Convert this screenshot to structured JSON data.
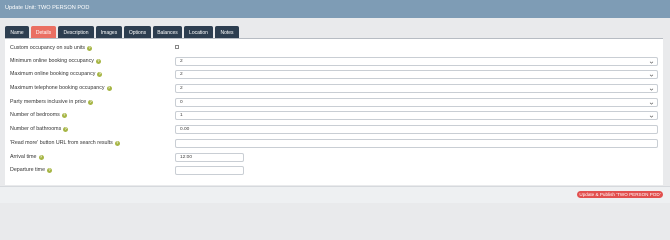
{
  "window": {
    "title": "Update Unit: TWO PERSON POD"
  },
  "tabs": [
    {
      "label": "Name",
      "active": false
    },
    {
      "label": "Details",
      "active": true
    },
    {
      "label": "Description",
      "active": false
    },
    {
      "label": "Images",
      "active": false
    },
    {
      "label": "Options",
      "active": false
    },
    {
      "label": "Balances",
      "active": false
    },
    {
      "label": "Location",
      "active": false
    },
    {
      "label": "Notes",
      "active": false
    }
  ],
  "form": {
    "custom_occupancy": {
      "label": "Custom occupancy on sub units",
      "checked": false
    },
    "min_online_occupancy": {
      "label": "Minimum online booking occupancy",
      "value": "2"
    },
    "max_online_occupancy": {
      "label": "Maximum online booking occupancy",
      "value": "2"
    },
    "max_phone_occupancy": {
      "label": "Maximum telephone booking occupancy",
      "value": "2"
    },
    "party_members_inclusive": {
      "label": "Party members inclusive in price",
      "value": "0"
    },
    "bedrooms": {
      "label": "Number of bedrooms",
      "value": "1"
    },
    "bathrooms": {
      "label": "Number of bathrooms",
      "value": "0.00"
    },
    "read_more_url": {
      "label": "'Read more' button URL from search results",
      "value": ""
    },
    "arrival_time": {
      "label": "Arrival time",
      "value": "12:00"
    },
    "departure_time": {
      "label": "Departure time",
      "value": ""
    }
  },
  "footer": {
    "publish_label": "Update & Publish 'TWO PERSON POD'"
  },
  "colors": {
    "accent": "#ea6f62",
    "tab": "#2d3e50",
    "titlebar": "#7e9cb5",
    "help": "#a6b544",
    "publish": "#e2504f"
  },
  "icons": {
    "help": "help-icon",
    "dropdown": "chevron-down-icon"
  }
}
